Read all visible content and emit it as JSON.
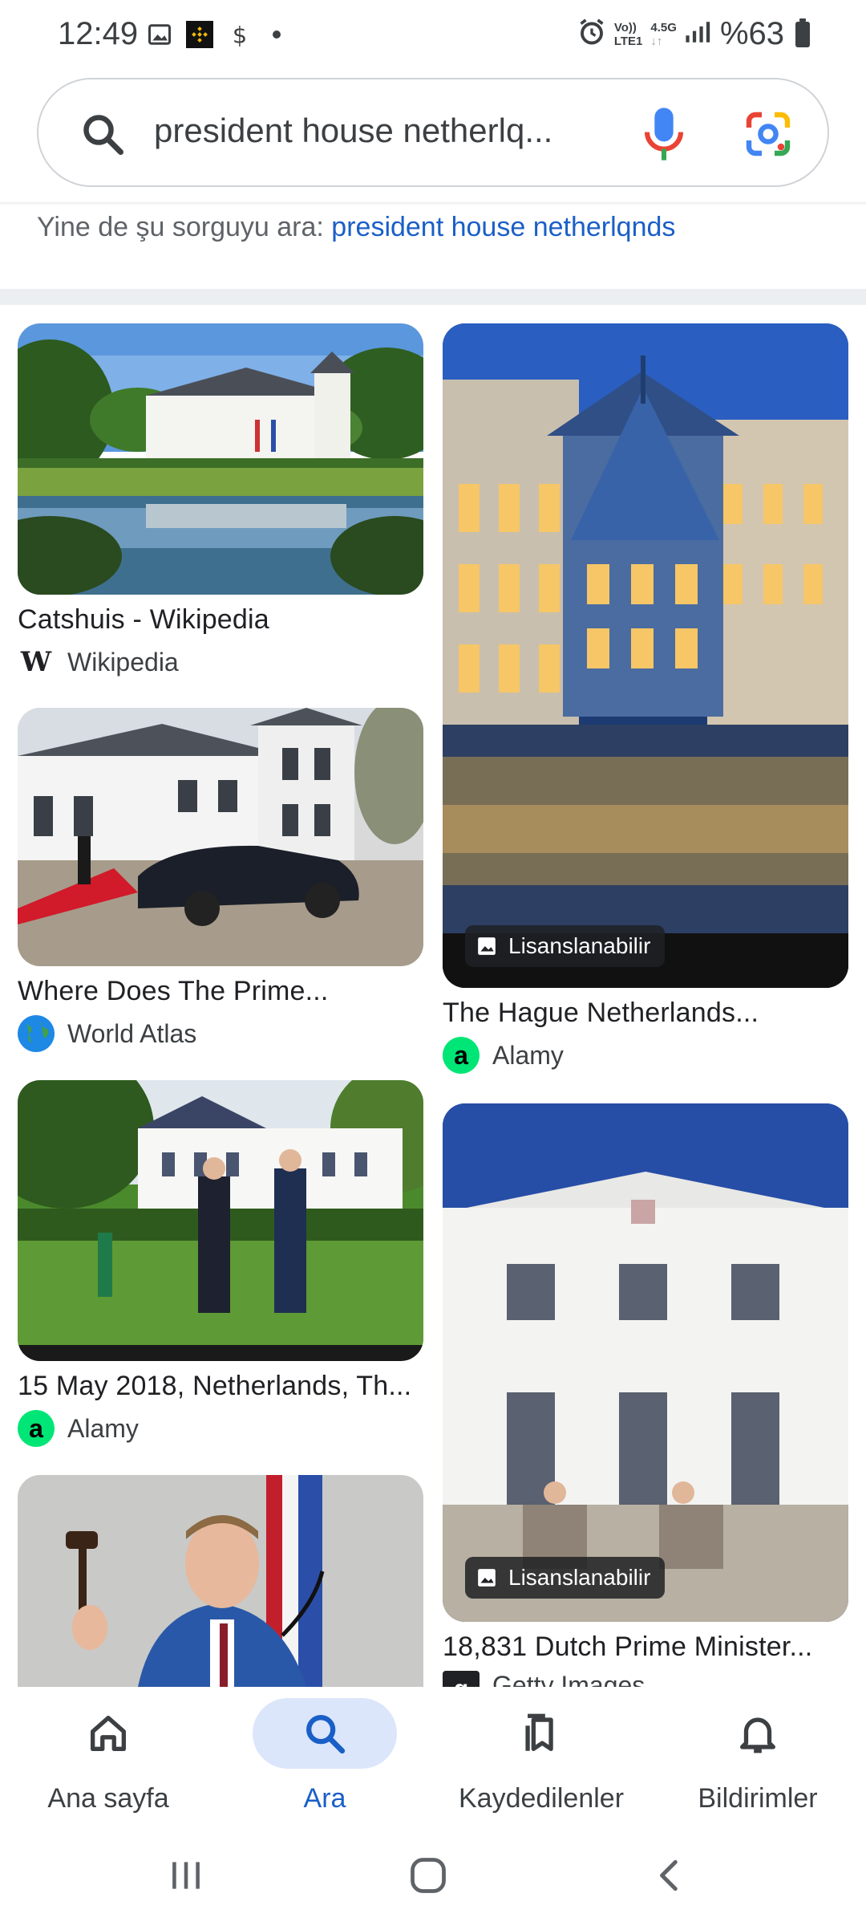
{
  "status_bar": {
    "time": "12:49",
    "network_top": "Vo))",
    "network_bottom": "LTE1",
    "speed_top": "4.5G",
    "speed_bottom": "↓↑",
    "battery": "%63",
    "icons": [
      "image-icon",
      "binance-icon",
      "dollar-icon",
      "dot-icon",
      "alarm-icon",
      "signal-icon",
      "battery-icon"
    ]
  },
  "search": {
    "query": "president house netherlq...",
    "icons": [
      "search-icon",
      "mic-icon",
      "lens-icon"
    ]
  },
  "did_you_mean": {
    "prefix": "Yine de şu sorguyu ara: ",
    "link": "president house netherlqnds"
  },
  "results": [
    {
      "title": "Catshuis - Wikipedia",
      "source": "Wikipedia",
      "favicon": "W",
      "licensable": false
    },
    {
      "title": "The Hague Netherlands...",
      "source": "Alamy",
      "favicon": "a",
      "licensable": true,
      "badge": "Lisanslanabilir"
    },
    {
      "title": "Where Does The Prime...",
      "source": "World Atlas",
      "favicon": "globe",
      "licensable": false
    },
    {
      "title": "15 May 2018, Netherlands, Th...",
      "source": "Alamy",
      "favicon": "a",
      "licensable": false
    },
    {
      "title": "18,831 Dutch Prime Minister...",
      "source": "Getty Images",
      "favicon": "g",
      "licensable": true,
      "badge": "Lisanslanabilir"
    },
    {
      "title": "",
      "source": "",
      "licensable": false
    }
  ],
  "bottom_nav": [
    {
      "label": "Ana sayfa",
      "icon": "home-icon",
      "active": false
    },
    {
      "label": "Ara",
      "icon": "search-icon",
      "active": true
    },
    {
      "label": "Kaydedilenler",
      "icon": "bookmarks-icon",
      "active": false
    },
    {
      "label": "Bildirimler",
      "icon": "bell-icon",
      "active": false
    }
  ],
  "colors": {
    "accent": "#1a5fc7",
    "active_pill": "#dbe6fb",
    "alamy_green": "#00e676"
  }
}
